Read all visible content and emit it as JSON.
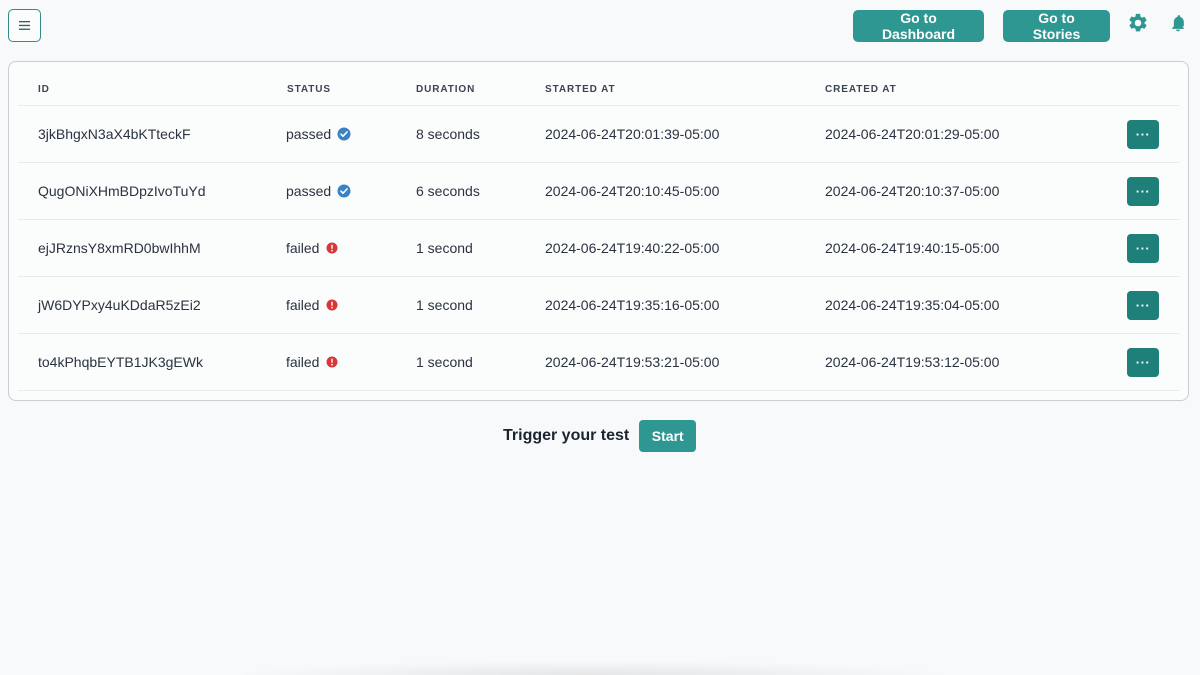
{
  "header": {
    "dashboard_label": "Go to Dashboard",
    "stories_label": "Go to Stories"
  },
  "colors": {
    "accent": "#2f9792",
    "row_action": "#1f7f79",
    "passed": "#3b82c4",
    "failed": "#d93636"
  },
  "table": {
    "columns": [
      "ID",
      "STATUS",
      "DURATION",
      "STARTED AT",
      "CREATED AT"
    ],
    "action_label": "···",
    "rows": [
      {
        "id": "3jkBhgxN3aX4bKTteckF",
        "status": "passed",
        "duration": "8 seconds",
        "started_at": "2024-06-24T20:01:39-05:00",
        "created_at": "2024-06-24T20:01:29-05:00"
      },
      {
        "id": "QugONiXHmBDpzIvoTuYd",
        "status": "passed",
        "duration": "6 seconds",
        "started_at": "2024-06-24T20:10:45-05:00",
        "created_at": "2024-06-24T20:10:37-05:00"
      },
      {
        "id": "ejJRznsY8xmRD0bwIhhM",
        "status": "failed",
        "duration": "1 second",
        "started_at": "2024-06-24T19:40:22-05:00",
        "created_at": "2024-06-24T19:40:15-05:00"
      },
      {
        "id": "jW6DYPxy4uKDdaR5zEi2",
        "status": "failed",
        "duration": "1 second",
        "started_at": "2024-06-24T19:35:16-05:00",
        "created_at": "2024-06-24T19:35:04-05:00"
      },
      {
        "id": "to4kPhqbEYTB1JK3gEWk",
        "status": "failed",
        "duration": "1 second",
        "started_at": "2024-06-24T19:53:21-05:00",
        "created_at": "2024-06-24T19:53:12-05:00"
      }
    ]
  },
  "trigger": {
    "text": "Trigger your test",
    "start_label": "Start"
  }
}
